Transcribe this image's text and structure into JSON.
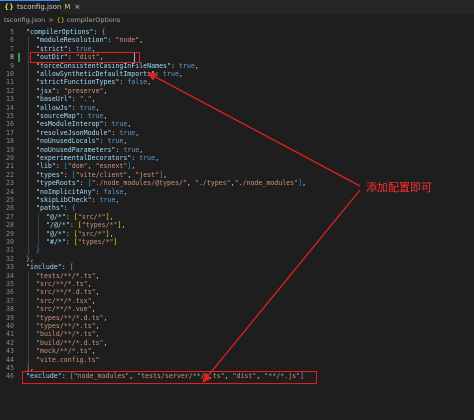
{
  "tab": {
    "filename": "tsconfig.json",
    "modified_marker": "M",
    "close": "×",
    "icon": "{}"
  },
  "breadcrumb": {
    "file": "tsconfig.json",
    "separator": ">",
    "symbol_icon": "{}",
    "symbol": "compilerOptions"
  },
  "annotation": {
    "text": "添加配置即可"
  },
  "colors": {
    "highlight": "#e02020",
    "key": "#9cdcfe",
    "string": "#ce9178",
    "boolean": "#569cd6"
  },
  "editor": {
    "lines": [
      {
        "n": "5",
        "indent": 1,
        "tokens": [
          [
            "k",
            "\"compilerOptions\""
          ],
          [
            "p",
            ": "
          ],
          [
            "br2",
            "{"
          ]
        ]
      },
      {
        "n": "6",
        "indent": 2,
        "tokens": [
          [
            "k",
            "\"moduleResolution\""
          ],
          [
            "p",
            ": "
          ],
          [
            "s",
            "\"node\""
          ],
          [
            "p",
            ","
          ]
        ]
      },
      {
        "n": "7",
        "indent": 2,
        "tokens": [
          [
            "k",
            "\"strict\""
          ],
          [
            "p",
            ": "
          ],
          [
            "b",
            "true"
          ],
          [
            "p",
            ","
          ]
        ]
      },
      {
        "n": "8",
        "indent": 2,
        "tokens": [
          [
            "k",
            "\"outDir\""
          ],
          [
            "p",
            ": "
          ],
          [
            "s",
            "\"dist\""
          ],
          [
            "p",
            ","
          ]
        ]
      },
      {
        "n": "9",
        "indent": 2,
        "tokens": [
          [
            "k",
            "\"forceConsistentCasingInFileNames\""
          ],
          [
            "p",
            ": "
          ],
          [
            "b",
            "true"
          ],
          [
            "p",
            ","
          ]
        ]
      },
      {
        "n": "10",
        "indent": 2,
        "tokens": [
          [
            "k",
            "\"allowSyntheticDefaultImports\""
          ],
          [
            "p",
            ": "
          ],
          [
            "b",
            "true"
          ],
          [
            "p",
            ","
          ]
        ]
      },
      {
        "n": "11",
        "indent": 2,
        "tokens": [
          [
            "k",
            "\"strictFunctionTypes\""
          ],
          [
            "p",
            ": "
          ],
          [
            "b",
            "false"
          ],
          [
            "p",
            ","
          ]
        ]
      },
      {
        "n": "12",
        "indent": 2,
        "tokens": [
          [
            "k",
            "\"jsx\""
          ],
          [
            "p",
            ": "
          ],
          [
            "s",
            "\"preserve\""
          ],
          [
            "p",
            ","
          ]
        ]
      },
      {
        "n": "13",
        "indent": 2,
        "tokens": [
          [
            "k",
            "\"baseUrl\""
          ],
          [
            "p",
            ": "
          ],
          [
            "s",
            "\".\""
          ],
          [
            "p",
            ","
          ]
        ]
      },
      {
        "n": "14",
        "indent": 2,
        "tokens": [
          [
            "k",
            "\"allowJs\""
          ],
          [
            "p",
            ": "
          ],
          [
            "b",
            "true"
          ],
          [
            "p",
            ","
          ]
        ]
      },
      {
        "n": "15",
        "indent": 2,
        "tokens": [
          [
            "k",
            "\"sourceMap\""
          ],
          [
            "p",
            ": "
          ],
          [
            "b",
            "true"
          ],
          [
            "p",
            ","
          ]
        ]
      },
      {
        "n": "16",
        "indent": 2,
        "tokens": [
          [
            "k",
            "\"esModuleInterop\""
          ],
          [
            "p",
            ": "
          ],
          [
            "b",
            "true"
          ],
          [
            "p",
            ","
          ]
        ]
      },
      {
        "n": "17",
        "indent": 2,
        "tokens": [
          [
            "k",
            "\"resolveJsonModule\""
          ],
          [
            "p",
            ": "
          ],
          [
            "b",
            "true"
          ],
          [
            "p",
            ","
          ]
        ]
      },
      {
        "n": "18",
        "indent": 2,
        "tokens": [
          [
            "k",
            "\"noUnusedLocals\""
          ],
          [
            "p",
            ": "
          ],
          [
            "b",
            "true"
          ],
          [
            "p",
            ","
          ]
        ]
      },
      {
        "n": "19",
        "indent": 2,
        "tokens": [
          [
            "k",
            "\"noUnusedParameters\""
          ],
          [
            "p",
            ": "
          ],
          [
            "b",
            "true"
          ],
          [
            "p",
            ","
          ]
        ]
      },
      {
        "n": "20",
        "indent": 2,
        "tokens": [
          [
            "k",
            "\"experimentalDecorators\""
          ],
          [
            "p",
            ": "
          ],
          [
            "b",
            "true"
          ],
          [
            "p",
            ","
          ]
        ]
      },
      {
        "n": "21",
        "indent": 2,
        "tokens": [
          [
            "k",
            "\"lib\""
          ],
          [
            "p",
            ": "
          ],
          [
            "br3",
            "["
          ],
          [
            "s",
            "\"dom\""
          ],
          [
            "p",
            ", "
          ],
          [
            "s",
            "\"esnext\""
          ],
          [
            "br3",
            "]"
          ],
          [
            "p",
            ","
          ]
        ]
      },
      {
        "n": "22",
        "indent": 2,
        "tokens": [
          [
            "k",
            "\"types\""
          ],
          [
            "p",
            ": "
          ],
          [
            "br3",
            "["
          ],
          [
            "s",
            "\"vite/client\""
          ],
          [
            "p",
            ", "
          ],
          [
            "s",
            "\"jest\""
          ],
          [
            "br3",
            "]"
          ],
          [
            "p",
            ","
          ]
        ]
      },
      {
        "n": "23",
        "indent": 2,
        "tokens": [
          [
            "k",
            "\"typeRoots\""
          ],
          [
            "p",
            ": "
          ],
          [
            "br3",
            "["
          ],
          [
            "s",
            "\"./node_modules/@types/\""
          ],
          [
            "p",
            ", "
          ],
          [
            "s",
            "\"./types\""
          ],
          [
            "p",
            ","
          ],
          [
            "s",
            "\"./node_modules\""
          ],
          [
            "br3",
            "]"
          ],
          [
            "p",
            ","
          ]
        ]
      },
      {
        "n": "24",
        "indent": 2,
        "tokens": [
          [
            "k",
            "\"noImplicitAny\""
          ],
          [
            "p",
            ": "
          ],
          [
            "b",
            "false"
          ],
          [
            "p",
            ","
          ]
        ]
      },
      {
        "n": "25",
        "indent": 2,
        "tokens": [
          [
            "k",
            "\"skipLibCheck\""
          ],
          [
            "p",
            ": "
          ],
          [
            "b",
            "true"
          ],
          [
            "p",
            ","
          ]
        ]
      },
      {
        "n": "26",
        "indent": 2,
        "tokens": [
          [
            "k",
            "\"paths\""
          ],
          [
            "p",
            ": "
          ],
          [
            "br3",
            "{"
          ]
        ]
      },
      {
        "n": "27",
        "indent": 3,
        "tokens": [
          [
            "k",
            "\"@/*\""
          ],
          [
            "p",
            ": "
          ],
          [
            "br1",
            "["
          ],
          [
            "s",
            "\"src/*\""
          ],
          [
            "br1",
            "]"
          ],
          [
            "p",
            ","
          ]
        ]
      },
      {
        "n": "28",
        "indent": 3,
        "tokens": [
          [
            "k",
            "\"/@/*\""
          ],
          [
            "p",
            ": "
          ],
          [
            "br1",
            "["
          ],
          [
            "s",
            "\"types/*\""
          ],
          [
            "br1",
            "]"
          ],
          [
            "p",
            ","
          ]
        ]
      },
      {
        "n": "29",
        "indent": 3,
        "tokens": [
          [
            "k",
            "\"@/*\""
          ],
          [
            "p",
            ": "
          ],
          [
            "br1",
            "["
          ],
          [
            "s",
            "\"src/*\""
          ],
          [
            "br1",
            "]"
          ],
          [
            "p",
            ","
          ]
        ]
      },
      {
        "n": "30",
        "indent": 3,
        "tokens": [
          [
            "k",
            "\"#/*\""
          ],
          [
            "p",
            ": "
          ],
          [
            "br1",
            "["
          ],
          [
            "s",
            "\"types/*\""
          ],
          [
            "br1",
            "]"
          ]
        ]
      },
      {
        "n": "31",
        "indent": 2,
        "tokens": [
          [
            "br3",
            "}"
          ]
        ]
      },
      {
        "n": "32",
        "indent": 1,
        "tokens": [
          [
            "br2",
            "}"
          ],
          [
            "p",
            ","
          ]
        ]
      },
      {
        "n": "33",
        "indent": 1,
        "tokens": [
          [
            "k",
            "\"include\""
          ],
          [
            "p",
            ": "
          ],
          [
            "br2",
            "["
          ]
        ]
      },
      {
        "n": "34",
        "indent": 2,
        "tokens": [
          [
            "s",
            "\"tests/**/*.ts\""
          ],
          [
            "p",
            ","
          ]
        ]
      },
      {
        "n": "35",
        "indent": 2,
        "tokens": [
          [
            "s",
            "\"src/**/*.ts\""
          ],
          [
            "p",
            ","
          ]
        ]
      },
      {
        "n": "36",
        "indent": 2,
        "tokens": [
          [
            "s",
            "\"src/**/*.d.ts\""
          ],
          [
            "p",
            ","
          ]
        ]
      },
      {
        "n": "37",
        "indent": 2,
        "tokens": [
          [
            "s",
            "\"src/**/*.tsx\""
          ],
          [
            "p",
            ","
          ]
        ]
      },
      {
        "n": "38",
        "indent": 2,
        "tokens": [
          [
            "s",
            "\"src/**/*.vue\""
          ],
          [
            "p",
            ","
          ]
        ]
      },
      {
        "n": "39",
        "indent": 2,
        "tokens": [
          [
            "s",
            "\"types/**/*.d.ts\""
          ],
          [
            "p",
            ","
          ]
        ]
      },
      {
        "n": "40",
        "indent": 2,
        "tokens": [
          [
            "s",
            "\"types/**/*.ts\""
          ],
          [
            "p",
            ","
          ]
        ]
      },
      {
        "n": "41",
        "indent": 2,
        "tokens": [
          [
            "s",
            "\"build/**/*.ts\""
          ],
          [
            "p",
            ","
          ]
        ]
      },
      {
        "n": "42",
        "indent": 2,
        "tokens": [
          [
            "s",
            "\"build/**/*.d.ts\""
          ],
          [
            "p",
            ","
          ]
        ]
      },
      {
        "n": "43",
        "indent": 2,
        "tokens": [
          [
            "s",
            "\"mock/**/*.ts\""
          ],
          [
            "p",
            ","
          ]
        ]
      },
      {
        "n": "44",
        "indent": 2,
        "tokens": [
          [
            "s",
            "\"vite.config.ts\""
          ]
        ]
      },
      {
        "n": "45",
        "indent": 1,
        "tokens": [
          [
            "br2",
            "]"
          ],
          [
            "p",
            ","
          ]
        ]
      },
      {
        "n": "46",
        "indent": 1,
        "tokens": [
          [
            "k",
            "\"exclude\""
          ],
          [
            "p",
            ": "
          ],
          [
            "br2",
            "["
          ],
          [
            "s",
            "\"node_modules\""
          ],
          [
            "p",
            ", "
          ],
          [
            "s",
            "\"tests/server/**/*.ts\""
          ],
          [
            "p",
            ", "
          ],
          [
            "s",
            "\"dist\""
          ],
          [
            "p",
            ", "
          ],
          [
            "s",
            "\"**/*.js\""
          ],
          [
            "br2",
            "]"
          ]
        ]
      }
    ]
  }
}
